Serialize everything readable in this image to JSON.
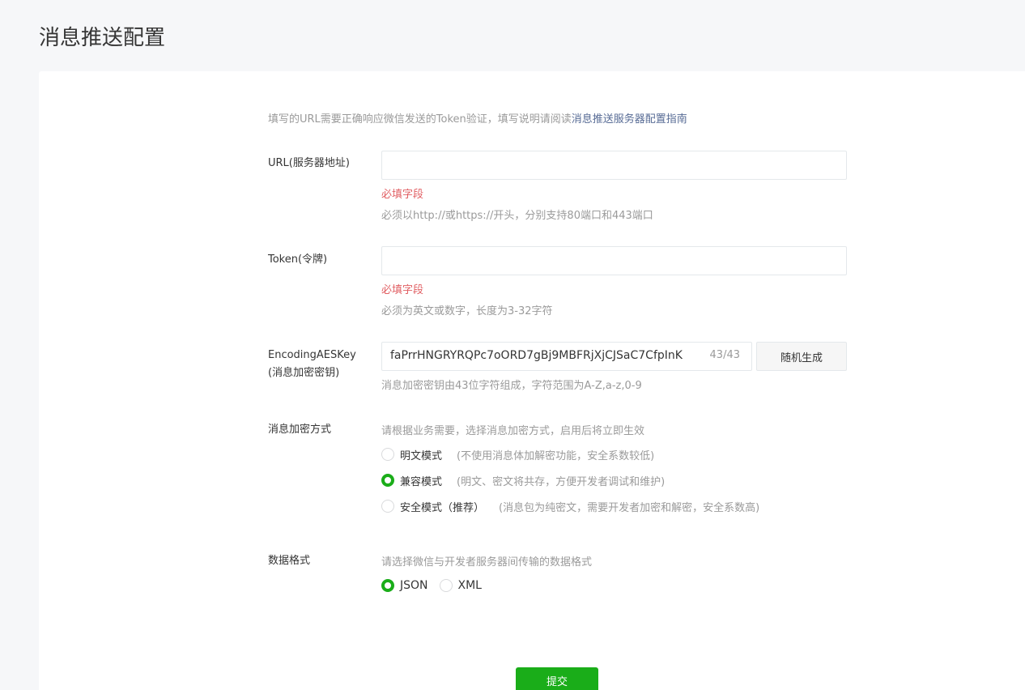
{
  "page": {
    "title": "消息推送配置"
  },
  "intro": {
    "text": "填写的URL需要正确响应微信发送的Token验证，填写说明请阅读",
    "link": "消息推送服务器配置指南"
  },
  "url_field": {
    "label": "URL(服务器地址)",
    "value": "",
    "error": "必填字段",
    "hint": "必须以http://或https://开头，分别支持80端口和443端口"
  },
  "token_field": {
    "label": "Token(令牌)",
    "value": "",
    "error": "必填字段",
    "hint": "必须为英文或数字，长度为3-32字符"
  },
  "aes_field": {
    "label_line1": "EncodingAESKey",
    "label_line2": "(消息加密密钥)",
    "value": "faPrrHNGRYRQPc7oORD7gBj9MBFRjXjCJSaC7CfpInK",
    "counter": "43/43",
    "generate_button": "随机生成",
    "hint": "消息加密密钥由43位字符组成，字符范围为A-Z,a-z,0-9"
  },
  "encrypt_mode": {
    "label": "消息加密方式",
    "hint": "请根据业务需要，选择消息加密方式，启用后将立即生效",
    "options": [
      {
        "label": "明文模式",
        "desc": "(不使用消息体加解密功能，安全系数较低)",
        "checked": false
      },
      {
        "label": "兼容模式",
        "desc": "(明文、密文将共存，方便开发者调试和维护)",
        "checked": true
      },
      {
        "label": "安全模式（推荐）",
        "desc": "(消息包为纯密文，需要开发者加密和解密，安全系数高)",
        "checked": false
      }
    ]
  },
  "data_format": {
    "label": "数据格式",
    "hint": "请选择微信与开发者服务器间传输的数据格式",
    "options": [
      {
        "label": "JSON",
        "checked": true
      },
      {
        "label": "XML",
        "checked": false
      }
    ]
  },
  "submit_button": "提交",
  "colors": {
    "accent": "#1aad19",
    "error": "#e15f63",
    "link": "#576b95",
    "hint": "#9a9a9a"
  }
}
